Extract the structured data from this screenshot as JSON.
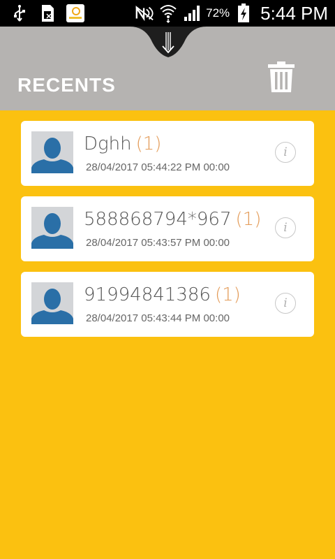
{
  "status_bar": {
    "battery_percent": "72%",
    "time": "5:44 PM",
    "icons": [
      "usb-icon",
      "sim-icon",
      "app-notification-icon",
      "nfc-off-icon",
      "wifi-icon",
      "signal-icon",
      "battery-charging-icon"
    ]
  },
  "header": {
    "title": "RECENTS",
    "pull_tab_icon": "pull-down-icon",
    "action_icon": "trash-icon",
    "background": "#B5B3B1"
  },
  "colors": {
    "background": "#FBC110",
    "count": "#E39A56",
    "avatar_bg": "#D3D5D8",
    "avatar_fg": "#2A6FA7"
  },
  "recents": [
    {
      "name": "Dghh",
      "count": "(1)",
      "datetime": "28/04/2017 05:44:22 PM",
      "duration": "00:00"
    },
    {
      "name": "588868794*967",
      "count": "(1)",
      "datetime": "28/04/2017 05:43:57 PM",
      "duration": "00:00"
    },
    {
      "name": "91994841386",
      "count": "(1)",
      "datetime": "28/04/2017 05:43:44 PM",
      "duration": "00:00"
    }
  ]
}
